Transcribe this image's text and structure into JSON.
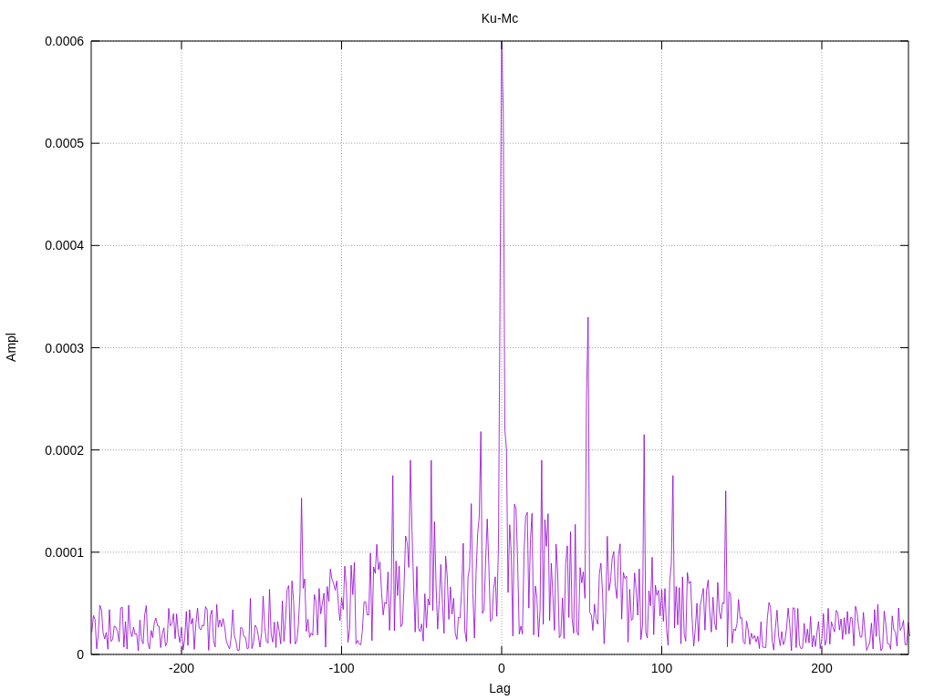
{
  "chart": {
    "title": "Ku-Mc",
    "xlabel": "Lag",
    "ylabel": "Ampl",
    "xticks": [
      "-200",
      "-100",
      "0",
      "100",
      "200"
    ],
    "yticks": [
      "0.0006",
      "0.0005",
      "0.0004",
      "0.0003",
      "0.0002",
      "0.0001",
      "0"
    ]
  }
}
